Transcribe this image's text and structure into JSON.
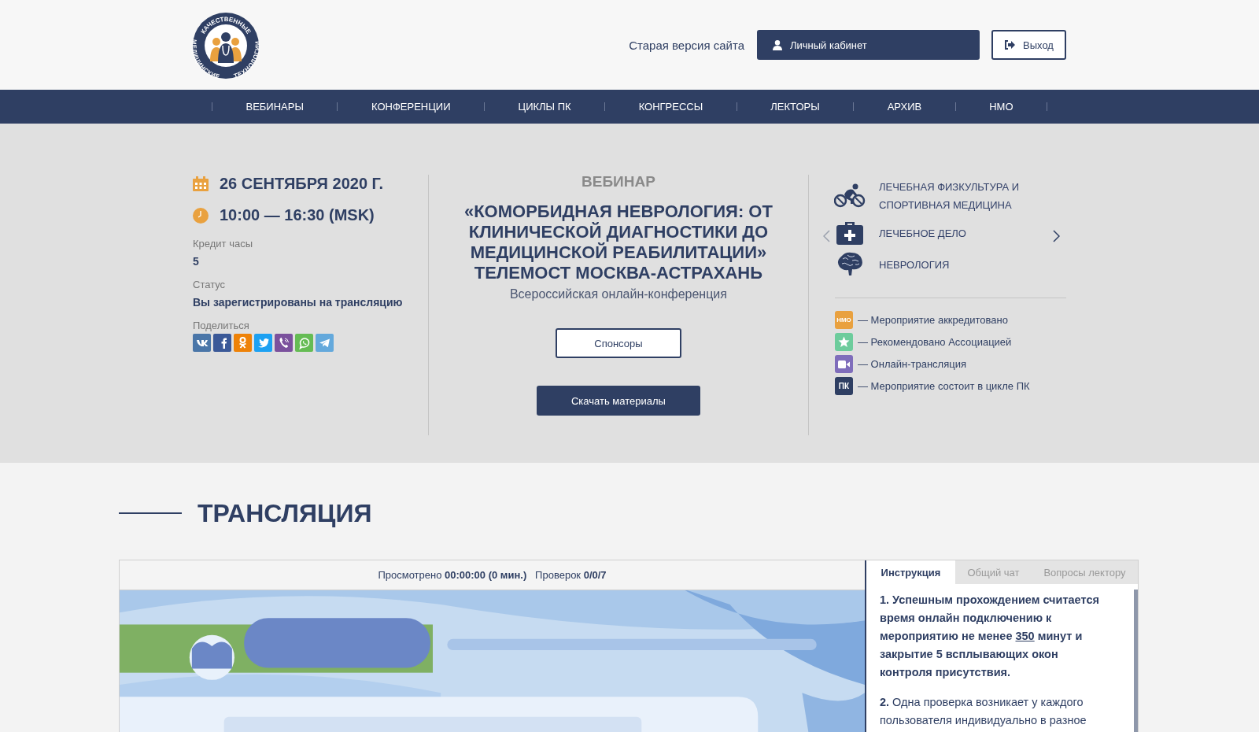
{
  "logo": {
    "text_top": "КАЧЕСТВЕННЫЕ",
    "text_bottom_left": "МЕДИЦИНСКИЕ",
    "text_bottom_right": "ТЕХНОЛОГИИ"
  },
  "header": {
    "old_site_link": "Старая версия сайта",
    "account_button": "Личный кабинет",
    "logout_button": "Выход"
  },
  "nav": {
    "items": [
      {
        "label": "ВЕБИНАРЫ"
      },
      {
        "label": "КОНФЕРЕНЦИИ"
      },
      {
        "label": "ЦИКЛЫ ПК"
      },
      {
        "label": "КОНГРЕССЫ"
      },
      {
        "label": "ЛЕКТОРЫ"
      },
      {
        "label": "АРХИВ"
      },
      {
        "label": "НМО"
      }
    ]
  },
  "event": {
    "date": "26 СЕНТЯБРЯ 2020 Г.",
    "time": "10:00 — 16:30 (MSK)",
    "credit_label": "Кредит часы",
    "credit_value": "5",
    "status_label": "Статус",
    "status_value": "Вы зарегистрированы на трансляцию",
    "share_label": "Поделиться",
    "share": [
      {
        "kind": "vk",
        "color": "#4a76a8"
      },
      {
        "kind": "facebook",
        "color": "#3b5998"
      },
      {
        "kind": "ok",
        "color": "#ee8208"
      },
      {
        "kind": "twitter",
        "color": "#1da1f2"
      },
      {
        "kind": "viber",
        "color": "#7b519d"
      },
      {
        "kind": "whatsapp",
        "color": "#65bc54"
      },
      {
        "kind": "telegram",
        "color": "#64a9dc"
      }
    ],
    "type": "ВЕБИНАР",
    "title": "«КОМОРБИДНАЯ НЕВРОЛОГИЯ: ОТ КЛИНИЧЕСКОЙ ДИАГНОСТИКИ ДО МЕДИЦИНСКОЙ РЕАБИЛИТАЦИИ» ТЕЛЕМОСТ МОСКВА-АСТРАХАНЬ",
    "subtitle": "Всероссийская онлайн-конференция",
    "sponsors_button": "Спонсоры",
    "download_button": "Скачать материалы",
    "specialties": [
      {
        "kind": "cycling",
        "label": "ЛЕЧЕБНАЯ ФИЗКУЛЬТУРА И СПОРТИВНАЯ МЕДИЦИНА"
      },
      {
        "kind": "medkit",
        "label": "ЛЕЧЕБНОЕ ДЕЛО"
      },
      {
        "kind": "brain",
        "label": "НЕВРОЛОГИЯ"
      }
    ],
    "legend": [
      {
        "kind": "text",
        "badge": "НМО",
        "color": "#e9a13f",
        "text": "— Мероприятие аккредитовано"
      },
      {
        "kind": "star",
        "color": "#6dcc9c",
        "text": "— Рекомендовано Ассоциацией"
      },
      {
        "kind": "video",
        "color": "#7f6dbb",
        "text": "— Онлайн-трансляция"
      },
      {
        "kind": "text",
        "badge": "ПК",
        "color": "#2f3f63",
        "text": "— Мероприятие состоит в цикле ПК"
      }
    ]
  },
  "stream": {
    "section_title": "ТРАНСЛЯЦИЯ",
    "stats": "Просмотрено **00:00:00 (0 мин.)**   Проверок **0/0/7**",
    "tabs": [
      {
        "label": "Инструкция",
        "selected": true
      },
      {
        "label": "Общий чат",
        "selected": false
      },
      {
        "label": "Вопросы лектору",
        "selected": false
      }
    ],
    "instructions": [
      {
        "bold": true,
        "text": "1. Успешным прохождением считается время онлайн подключению к мероприятию не менее ",
        "link": "350",
        "rest": " минут и закрытие 5 всплывающих окон контроля присутствия."
      },
      {
        "bold": false,
        "text": "**2.** Одна проверка возникает у каждого пользователя индивидуально в разное"
      }
    ]
  }
}
